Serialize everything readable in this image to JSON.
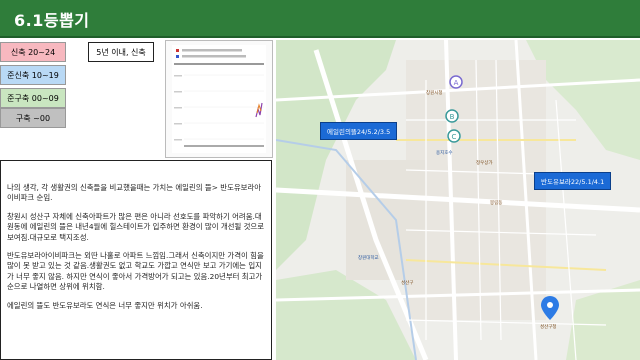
{
  "header": {
    "title": "6.1등뽑기"
  },
  "legend": [
    {
      "label": "신축 20~24",
      "color": "#f7b8bf"
    },
    {
      "label": "준신축 10~19",
      "color": "#b9d9f5"
    },
    {
      "label": "준구축 00~09",
      "color": "#c9e6c0"
    },
    {
      "label": "구축 ~00",
      "color": "#c0c0c0"
    }
  ],
  "filter": {
    "label": "5년 이내, 신축"
  },
  "body_text": [
    "나의 생각, 각 생활권의 신축들을 비교했을때는 가치는 에일린의 뜰> 반도유보라아이비파크 순임.",
    "창원시 성산구 자체에 신축아파트가 많은 편은 아니라 선호도를 파악하기 어려움.대원동에 에일린의 뜰은 내년4월에 힐스테이트가 입주하면 환경이 많이 개선될 것으로 보여짐.대규모로 택지조성.",
    "반도유보라아이비파크는 외딴 나홀로 아파트 느낌임.그래서 신축이지만 가격이 힘을 많이 못 받고 있는 것 같음.생활권도 없고 학교도 가깝고 연식만 보고 가기에는 입지가 너무 좋지 않음. 하지만 연식이 좋아서 가격방어가 되고는 있음.20년부터 최고가 순으로 나열하면 상위에 위치함.",
    "에일린의 뜰도 반도유보라도 연식은 너무 좋지만 위치가 아쉬움."
  ],
  "map": {
    "labels": [
      {
        "text": "에일린의뜰24/5.2/3.5"
      },
      {
        "text": "반도유보라22/5.1/4.1"
      }
    ],
    "markers": [
      "A",
      "B",
      "C"
    ],
    "places": [
      "창원시청",
      "성산구",
      "성산구청",
      "창원대학교",
      "정우상가",
      "봉림동",
      "용지호수"
    ]
  },
  "colors": {
    "header": "#2f7d3a",
    "label": "#1b6ad6",
    "pin": "#2d7be5"
  }
}
